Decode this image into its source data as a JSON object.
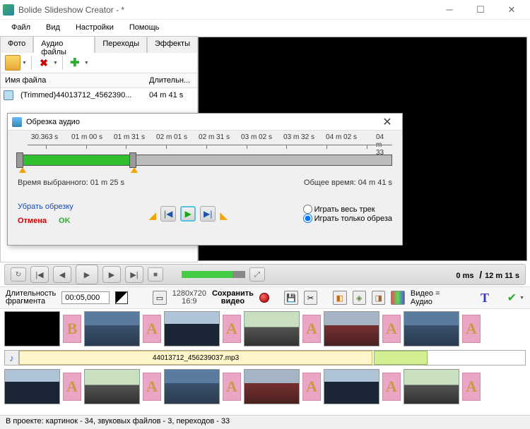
{
  "window": {
    "title": "Bolide Slideshow Creator - *"
  },
  "menu": {
    "file": "Файл",
    "view": "Вид",
    "settings": "Настройки",
    "help": "Помощь"
  },
  "tabs": {
    "photo": "Фото",
    "audio": "Аудио файлы",
    "transitions": "Переходы",
    "effects": "Эффекты"
  },
  "cols": {
    "name": "Имя файла",
    "length": "Длительн..."
  },
  "file": {
    "name": "(Trimmed)44013712_4562390...",
    "dur": "04 m 41 s"
  },
  "dlg": {
    "title": "Обрезка аудио",
    "ticks": [
      "30.363 s",
      "01 m 00 s",
      "01 m 31 s",
      "02 m 01 s",
      "02 m 31 s",
      "03 m 02 s",
      "03 m 32 s",
      "04 m 02 s",
      "04 m 33"
    ],
    "sel_label": "Время выбранного: 01 m 25 s",
    "total_label": "Общее время: 04 m 41 s",
    "remove": "Убрать обрезку",
    "cancel": "Отмена",
    "ok": "OK",
    "radio1": "Играть весь трек",
    "radio2": "Играть только обреза"
  },
  "player": {
    "time_a": "0 ms",
    "time_b": "12 m 11 s"
  },
  "tb": {
    "dur_label1": "Длительность",
    "dur_label2": "фрагмента",
    "dur_val": "00:05,000",
    "res_a": "1280x720",
    "res_b": "16:9",
    "save_a": "Сохранить",
    "save_b": "видео",
    "va": "Видео = Аудио"
  },
  "audio_clip": "44013712_456239037.mp3",
  "transitions": {
    "b": "B",
    "a": "A"
  },
  "status": "В проекте: картинок - 34, звуковых файлов - 3, переходов - 33"
}
